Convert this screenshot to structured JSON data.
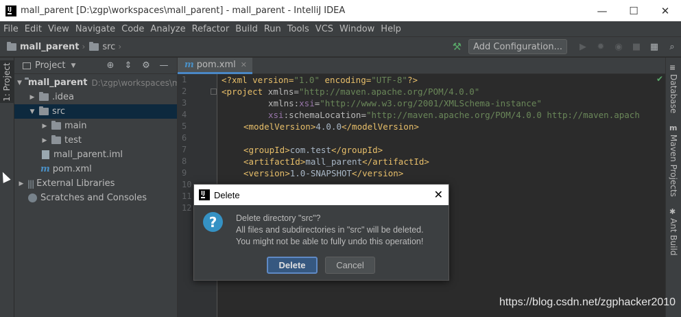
{
  "window": {
    "title": "mall_parent [D:\\zgp\\workspaces\\mall_parent] - mall_parent - IntelliJ IDEA",
    "app_icon_letter": "IJ",
    "minimize": "—",
    "maximize": "☐",
    "close": "✕"
  },
  "menu": [
    "File",
    "Edit",
    "View",
    "Navigate",
    "Code",
    "Analyze",
    "Refactor",
    "Build",
    "Run",
    "Tools",
    "VCS",
    "Window",
    "Help"
  ],
  "navbar": {
    "crumbs": [
      "mall_parent",
      "src"
    ],
    "add_configuration": "Add Configuration..."
  },
  "left_strip": {
    "tab_label": "1: Project"
  },
  "project_panel": {
    "title": "Project",
    "tree": [
      {
        "label": "mall_parent",
        "path": "D:\\zgp\\workspaces\\mall_parent"
      },
      {
        "label": ".idea"
      },
      {
        "label": "src"
      },
      {
        "label": "main"
      },
      {
        "label": "test"
      },
      {
        "label": "mall_parent.iml"
      },
      {
        "label": "pom.xml"
      },
      {
        "label": "External Libraries"
      },
      {
        "label": "Scratches and Consoles"
      }
    ]
  },
  "editor": {
    "tab": "pom.xml",
    "line_numbers": [
      "1",
      "2",
      "3",
      "4",
      "5",
      "6",
      "7",
      "8",
      "9",
      "10",
      "11",
      "12"
    ],
    "lines": {
      "l1_decl": "<?xml version=",
      "l1_v1": "\"1.0\"",
      "l1_enc": " encoding=",
      "l1_v2": "\"UTF-8\"",
      "l1_end": "?>",
      "l2_tag": "<project ",
      "l2_attr": "xmlns=",
      "l2_val": "\"http://maven.apache.org/POM/4.0.0\"",
      "l3_attr": "xmlns:",
      "l3_ns": "xsi",
      "l3_eq": "=",
      "l3_val": "\"http://www.w3.org/2001/XMLSchema-instance\"",
      "l4_ns": "xsi",
      "l4_attr": ":schemaLocation=",
      "l4_val": "\"http://maven.apache.org/POM/4.0.0 http://maven.apach",
      "l5_open": "<modelVersion>",
      "l5_text": "4.0.0",
      "l5_close": "</modelVersion>",
      "l7_open": "<groupId>",
      "l7_text": "com.test",
      "l7_close": "</groupId>",
      "l8_open": "<artifactId>",
      "l8_text": "mall_parent",
      "l8_close": "</artifactId>",
      "l9_open": "<version>",
      "l9_text": "1.0-SNAPSHOT",
      "l9_close": "</version>"
    }
  },
  "right_strip": [
    "Database",
    "Maven Projects",
    "Ant Build"
  ],
  "dialog": {
    "title": "Delete",
    "message_lines": [
      "Delete directory \"src\"?",
      "All files and subdirectories in \"src\" will be deleted.",
      "You might not be able to fully undo this operation!"
    ],
    "delete_label": "Delete",
    "cancel_label": "Cancel"
  },
  "watermark": "https://blog.csdn.net/zgphacker2010",
  "colors": {
    "accent": "#4a88c7",
    "selection": "#0d293e",
    "panel_bg": "#3c3f41",
    "editor_bg": "#2b2b2b"
  }
}
